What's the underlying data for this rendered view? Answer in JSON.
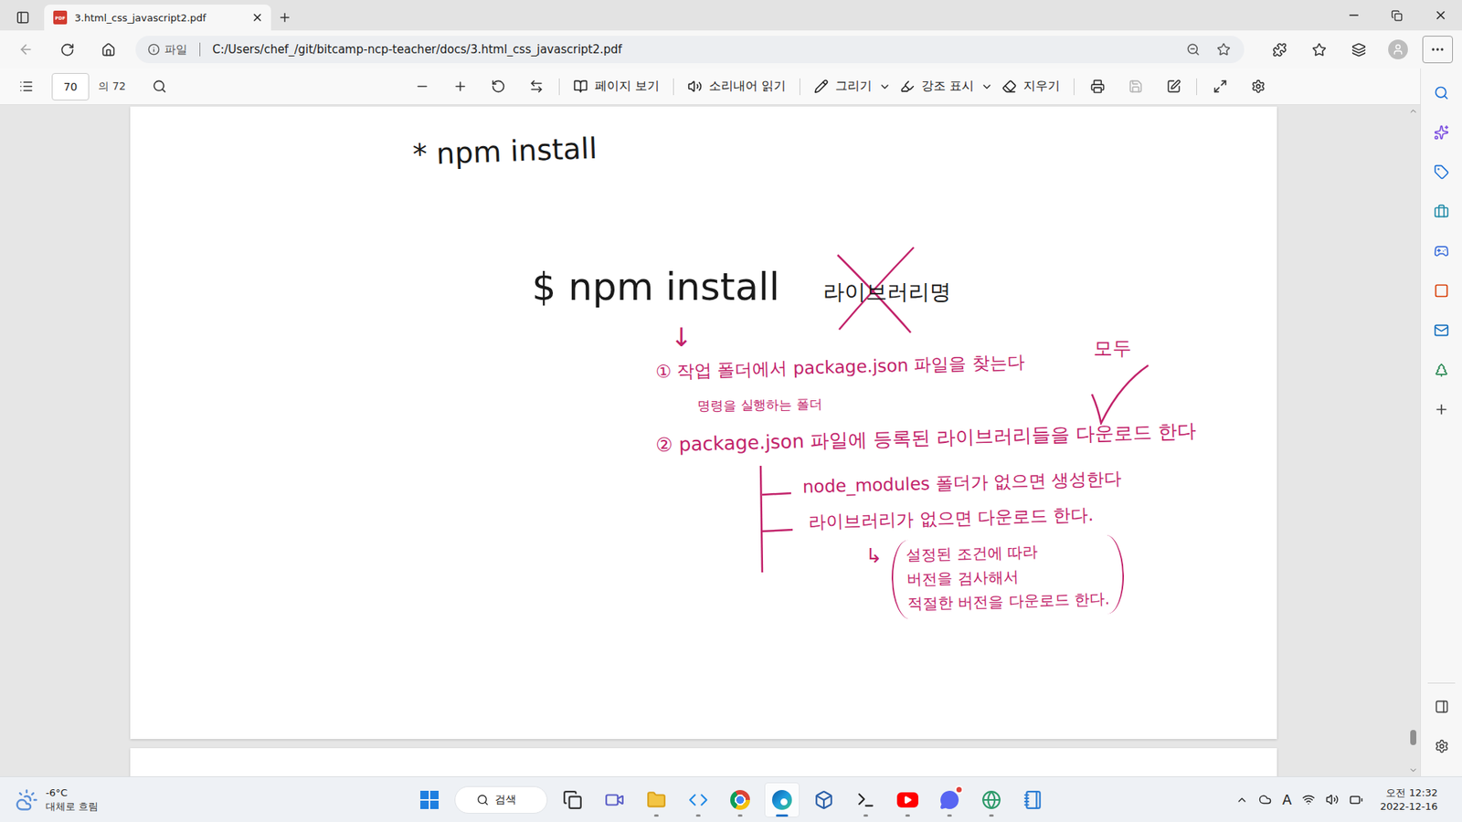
{
  "tabs": [
    {
      "label": "3.html_css_javascript2.pdf",
      "icon_text": "PDF",
      "selected": true
    }
  ],
  "address_bar": {
    "scheme_label": "파일",
    "url": "C:/Users/chef_/git/bitcamp-ncp-teacher/docs/3.html_css_javascript2.pdf"
  },
  "pdf_toolbar": {
    "page": "70",
    "page_total": "의 72",
    "tools": [
      {
        "label": "페이지 보기",
        "kind": "page-view",
        "dropdown": false
      },
      {
        "label": "소리내어 읽기",
        "kind": "read-aloud",
        "dropdown": false
      },
      {
        "label": "그리기",
        "kind": "draw",
        "dropdown": true
      },
      {
        "label": "강조 표시",
        "kind": "highlight",
        "dropdown": true
      },
      {
        "label": "지우기",
        "kind": "erase",
        "dropdown": false
      }
    ],
    "actions": [
      {
        "kind": "print",
        "disabled": false
      },
      {
        "kind": "save",
        "disabled": true
      },
      {
        "kind": "save-as",
        "disabled": false
      }
    ]
  },
  "document": {
    "notes": [
      {
        "kind": "title",
        "text": "* npm install",
        "color": "#1a1a1a"
      },
      {
        "kind": "command",
        "text": "$ npm install",
        "color": "#1a1a1a"
      },
      {
        "kind": "crossed",
        "text": "라이브러리명",
        "color": "#1a1a1a"
      },
      {
        "kind": "arrow",
        "text": "↓",
        "color": "#c2226a"
      },
      {
        "kind": "step1",
        "text": "① 작업 폴더에서 package.json 파일을 찾는다",
        "color": "#c2226a"
      },
      {
        "kind": "step1-sub",
        "text": "명령을 실행하는 폴더",
        "color": "#c2226a"
      },
      {
        "kind": "all",
        "text": "모두",
        "color": "#c2226a"
      },
      {
        "kind": "step2",
        "text": "② package.json 파일에 등록된 라이브러리들을 다운로드 한다",
        "color": "#c2226a"
      },
      {
        "kind": "item1",
        "text": "node_modules 폴더가 없으면 생성한다",
        "color": "#c2226a"
      },
      {
        "kind": "item2",
        "text": "라이브러리가 없으면 다운로드 한다.",
        "color": "#c2226a"
      },
      {
        "kind": "hook",
        "text": "↳",
        "color": "#c2226a"
      }
    ],
    "detail": {
      "lines": [
        "설정된 조건에 따라",
        "버전을 검사해서",
        "적절한 버전을 다운로드 한다."
      ],
      "color": "#c2226a"
    }
  },
  "scrollbar": {
    "level": 0.97
  },
  "sidebar": {
    "items": [
      {
        "kind": "search"
      },
      {
        "kind": "copilot"
      },
      {
        "kind": "shopping"
      },
      {
        "kind": "tools"
      },
      {
        "kind": "games"
      },
      {
        "kind": "office"
      },
      {
        "kind": "outlook"
      },
      {
        "kind": "tree"
      },
      {
        "kind": "add"
      }
    ],
    "footer": [
      {
        "kind": "panel"
      },
      {
        "kind": "settings"
      }
    ]
  },
  "taskbar": {
    "weather": {
      "temp": "-6°C",
      "desc": "대체로 흐림"
    },
    "search": "검색",
    "apps": [
      {
        "kind": "task-view",
        "running": false,
        "active": false,
        "badge": false
      },
      {
        "kind": "meet",
        "running": false,
        "active": false,
        "badge": false
      },
      {
        "kind": "files",
        "running": true,
        "active": false,
        "badge": false
      },
      {
        "kind": "vscode",
        "running": true,
        "active": false,
        "badge": false
      },
      {
        "kind": "chrome",
        "running": true,
        "active": false,
        "badge": false
      },
      {
        "kind": "edge",
        "running": true,
        "active": true,
        "badge": false
      },
      {
        "kind": "virtualbox",
        "running": false,
        "active": false,
        "badge": false
      },
      {
        "kind": "terminal",
        "running": true,
        "active": false,
        "badge": false
      },
      {
        "kind": "youtube",
        "running": true,
        "active": false,
        "badge": false
      },
      {
        "kind": "discord",
        "running": true,
        "active": false,
        "badge": true
      },
      {
        "kind": "maps",
        "running": true,
        "active": false,
        "badge": false
      },
      {
        "kind": "notepad",
        "running": false,
        "active": false,
        "badge": false
      }
    ],
    "ime": "A",
    "clock": {
      "time": "오전 12:32",
      "date": "2022-12-16"
    }
  }
}
